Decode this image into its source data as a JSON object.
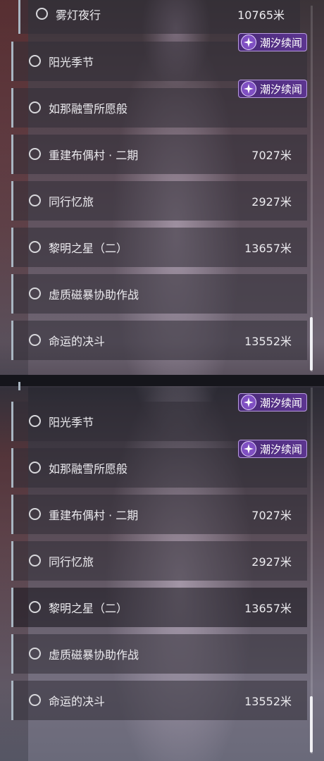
{
  "panels": [
    {
      "first_item": {
        "name": "雾灯夜行",
        "distance": "10765米"
      },
      "items": [
        {
          "name": "阳光季节",
          "distance": "",
          "badge": "潮汐续闻"
        },
        {
          "name": "如那融雪所愿般",
          "distance": "",
          "badge": "潮汐续闻"
        },
        {
          "name": "重建布偶村 · 二期",
          "distance": "7027米"
        },
        {
          "name": "同行忆旅",
          "distance": "2927米"
        },
        {
          "name": "黎明之星（二）",
          "distance": "13657米"
        },
        {
          "name": "虚质磁暴协助作战",
          "distance": ""
        },
        {
          "name": "命运的决斗",
          "distance": "13552米"
        }
      ]
    },
    {
      "items": [
        {
          "name": "阳光季节",
          "distance": "",
          "badge": "潮汐续闻"
        },
        {
          "name": "如那融雪所愿般",
          "distance": "",
          "badge": "潮汐续闻"
        },
        {
          "name": "重建布偶村 · 二期",
          "distance": "7027米"
        },
        {
          "name": "同行忆旅",
          "distance": "2927米"
        },
        {
          "name": "黎明之星（二）",
          "distance": "13657米",
          "highlighted": true
        },
        {
          "name": "虚质磁暴协助作战",
          "distance": ""
        },
        {
          "name": "命运的决斗",
          "distance": "13552米"
        }
      ]
    }
  ],
  "icons": {
    "radio": "radio-circle-icon",
    "badge": "tide-sparkle-icon"
  },
  "colors": {
    "accent_border": "#a9b6c2",
    "badge_bg": "#5c3590",
    "text": "#ecebef"
  }
}
